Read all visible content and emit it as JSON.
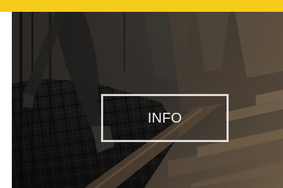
{
  "card": {
    "button_label": "INFO",
    "accent_color": "#f5cc1a",
    "image_subject": "construction-worker-on-rebar-mesh"
  }
}
